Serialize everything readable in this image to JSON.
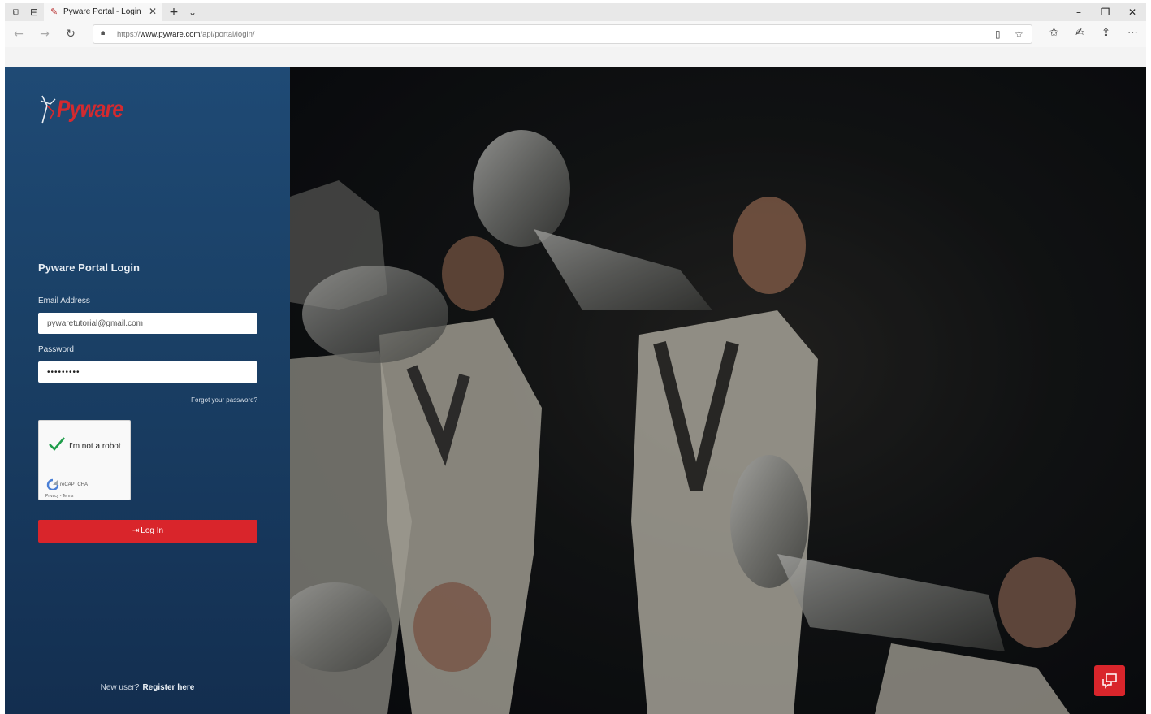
{
  "browser": {
    "tab_title": "Pyware Portal - Login",
    "new_tab_icon": "plus-icon",
    "url_scheme": "https://",
    "url_host": "www.pyware.com",
    "url_path": "/api/portal/login/"
  },
  "login": {
    "brand": "Pyware",
    "title": "Pyware Portal Login",
    "email_label": "Email Address",
    "email_value": "pywaretutorial@gmail.com",
    "password_label": "Password",
    "password_value": "•••••••••",
    "forgot_link": "Forgot your password?",
    "button_label": "Log In",
    "register_prompt": "New user?",
    "register_link": "Register here"
  },
  "captcha": {
    "label": "I'm not a robot",
    "brand": "reCAPTCHA",
    "terms": "Privacy - Terms",
    "checked": true
  },
  "colors": {
    "accent": "#d9252b",
    "panel": "#1a4066"
  }
}
